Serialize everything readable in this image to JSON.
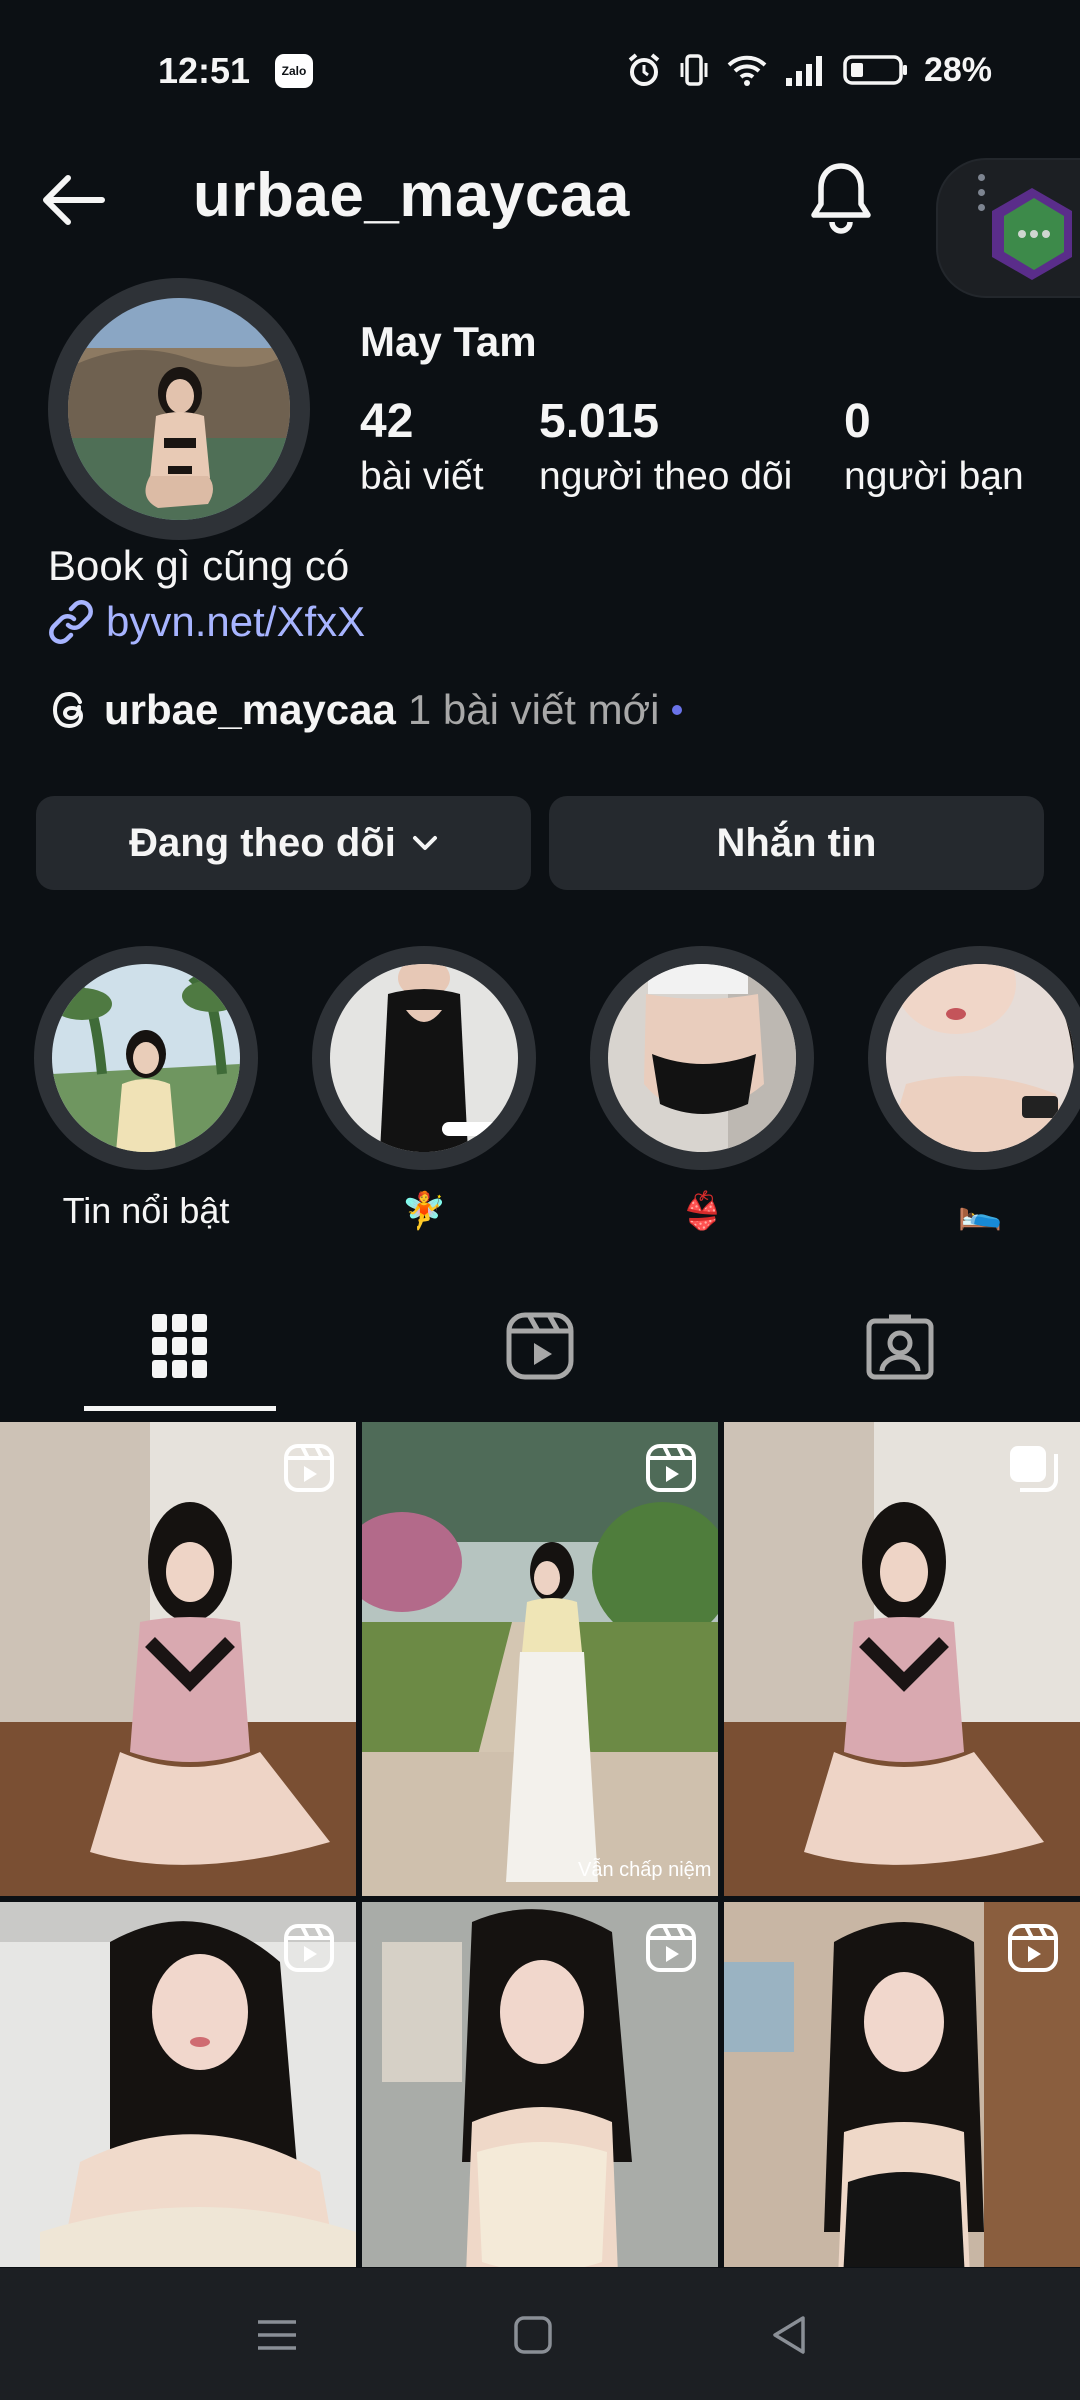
{
  "status_bar": {
    "time": "12:51",
    "notification_app": "Zalo",
    "battery": "28%"
  },
  "header": {
    "username": "urbae_maycaa"
  },
  "profile": {
    "display_name": "May Tam",
    "stats": [
      {
        "value": "42",
        "label": "bài viết"
      },
      {
        "value": "5.015",
        "label": "người theo dõi"
      },
      {
        "value": "0",
        "label": "người bạn"
      }
    ],
    "bio": "Book gì cũng có",
    "link": "byvn.net/XfxX",
    "threads": {
      "username": "urbae_maycaa",
      "new_posts": "1 bài viết mới"
    }
  },
  "actions": {
    "follow_label": "Đang theo dõi",
    "message_label": "Nhắn tin"
  },
  "highlights": [
    {
      "label": "Tin nổi bật"
    },
    {
      "label": "🧚"
    },
    {
      "label": "👙"
    },
    {
      "label": "🛌"
    }
  ],
  "tabs": [
    {
      "icon": "grid-icon"
    },
    {
      "icon": "reels-icon"
    },
    {
      "icon": "tagged-icon"
    }
  ],
  "posts": [
    {
      "type": "reel",
      "caption": ""
    },
    {
      "type": "reel",
      "caption": "Vẫn chấp niệm"
    },
    {
      "type": "carousel",
      "caption": ""
    },
    {
      "type": "reel",
      "caption": ""
    },
    {
      "type": "reel",
      "caption": ""
    },
    {
      "type": "reel",
      "caption": ""
    }
  ],
  "colors": {
    "background": "#0c1014",
    "button": "#25292e",
    "link": "#a7b4ff",
    "muted": "#a8a8a8",
    "accent_dot": "#6a73e9"
  }
}
